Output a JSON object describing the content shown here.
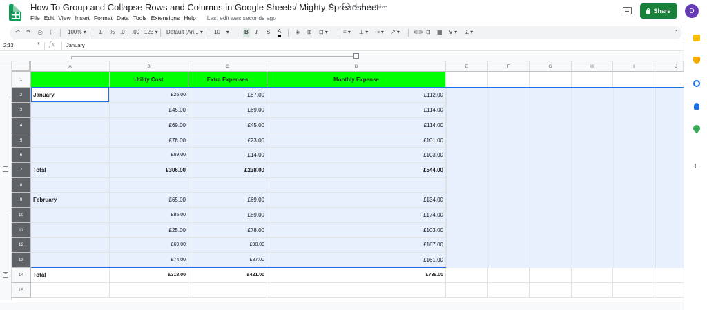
{
  "app": {
    "title": "How To Group and Collapse Rows and Columns in Google Sheets/ Mighty Spreadsheet",
    "save_status": "Saved to Drive",
    "menu": [
      "File",
      "Edit",
      "View",
      "Insert",
      "Format",
      "Data",
      "Tools",
      "Extensions",
      "Help"
    ],
    "last_edit": "Last edit was seconds ago",
    "share_label": "Share",
    "avatar_initial": "D",
    "brand_color": "#0f9d58",
    "share_color": "#188038"
  },
  "toolbar": {
    "zoom": "100%",
    "currency": "£",
    "percent": "%",
    "dec_less": ".0_",
    "dec_more": ".00",
    "more_formats": "123",
    "font": "Default (Ari...",
    "font_size": "10",
    "bold": "B",
    "italic": "I",
    "strike": "S",
    "text_color": "A"
  },
  "formula_bar": {
    "cell_ref": "2:13",
    "value": "January"
  },
  "grid": {
    "columns": [
      "A",
      "B",
      "C",
      "D",
      "E",
      "F",
      "G",
      "H",
      "I",
      "J"
    ],
    "header_fill": "#00ff00",
    "band_fill": "#e8f0fe",
    "headers": {
      "b": "Utility Cost",
      "c": "Extra Expenses",
      "d": "Monthly Expense"
    },
    "rows": [
      {
        "n": "1",
        "a": "",
        "b": "",
        "c": "",
        "d": ""
      },
      {
        "n": "2",
        "a": "January",
        "b": "£25.00",
        "c": "£87.00",
        "d": "£112.00"
      },
      {
        "n": "3",
        "a": "",
        "b": "£45.00",
        "c": "£69.00",
        "d": "£114.00"
      },
      {
        "n": "4",
        "a": "",
        "b": "£69.00",
        "c": "£45.00",
        "d": "£114.00"
      },
      {
        "n": "5",
        "a": "",
        "b": "£78.00",
        "c": "£23.00",
        "d": "£101.00"
      },
      {
        "n": "6",
        "a": "",
        "b": "£89.00",
        "c": "£14.00",
        "d": "£103.00"
      },
      {
        "n": "7",
        "a": "Total",
        "b": "£306.00",
        "c": "£238.00",
        "d": "£544.00"
      },
      {
        "n": "8",
        "a": "",
        "b": "",
        "c": "",
        "d": ""
      },
      {
        "n": "9",
        "a": "February",
        "b": "£65.00",
        "c": "£69.00",
        "d": "£134.00"
      },
      {
        "n": "10",
        "a": "",
        "b": "£85.00",
        "c": "£89.00",
        "d": "£174.00"
      },
      {
        "n": "11",
        "a": "",
        "b": "£25.00",
        "c": "£78.00",
        "d": "£103.00"
      },
      {
        "n": "12",
        "a": "",
        "b": "£69.00",
        "c": "£98.00",
        "d": "£167.00"
      },
      {
        "n": "13",
        "a": "",
        "b": "£74.00",
        "c": "£87.00",
        "d": "£161.00"
      },
      {
        "n": "14",
        "a": "Total",
        "b": "£318.00",
        "c": "£421.00",
        "d": "£739.00"
      },
      {
        "n": "15",
        "a": "",
        "b": "",
        "c": "",
        "d": ""
      }
    ]
  }
}
